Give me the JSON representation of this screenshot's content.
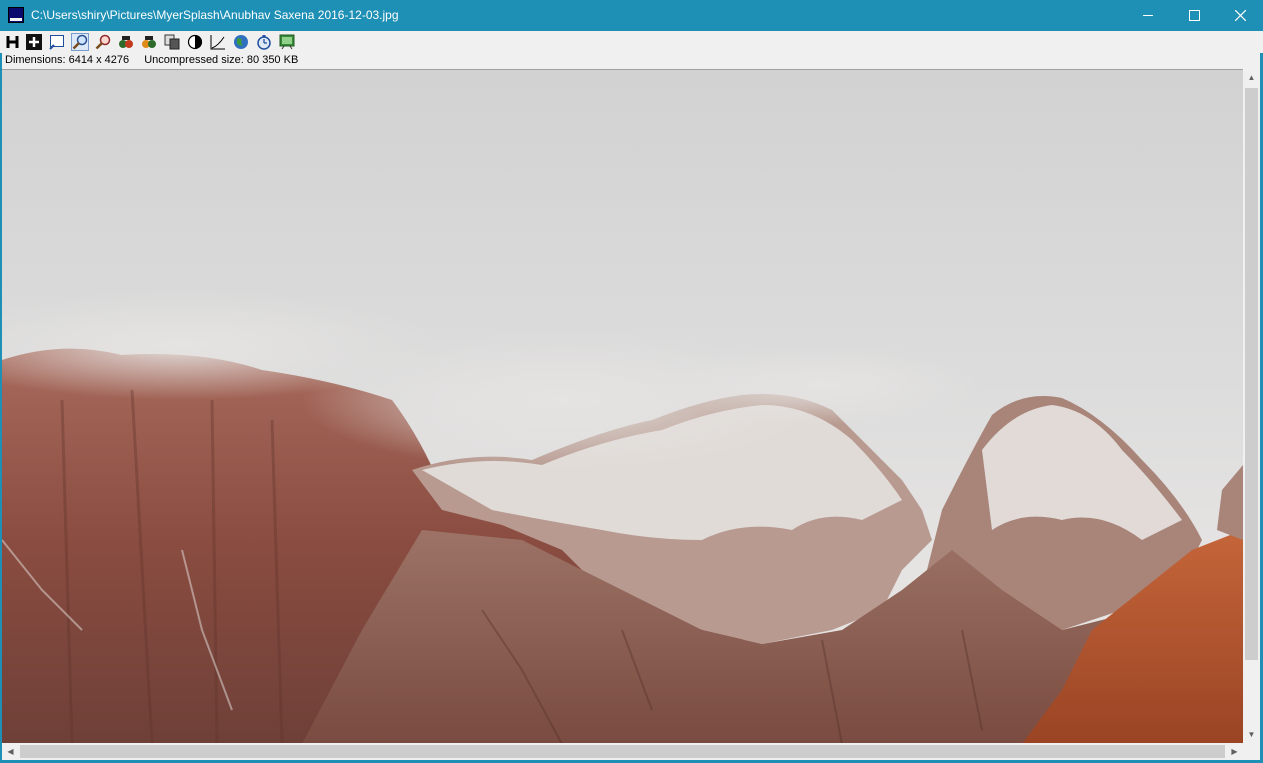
{
  "window": {
    "title": "C:\\Users\\shiry\\Pictures\\MyerSplash\\Anubhav Saxena  2016-12-03.jpg",
    "controls": [
      "minimize",
      "maximize",
      "close"
    ]
  },
  "toolbar": {
    "buttons": [
      {
        "icon": "histogram-h-icon",
        "label": "H"
      },
      {
        "icon": "add-plus-icon"
      },
      {
        "icon": "fit-window-icon"
      },
      {
        "icon": "zoom-in-icon",
        "active": true
      },
      {
        "icon": "zoom-out-icon"
      },
      {
        "icon": "red-eye-icon"
      },
      {
        "icon": "color-icon"
      },
      {
        "icon": "copy-icon"
      },
      {
        "icon": "contrast-icon"
      },
      {
        "icon": "curve-icon"
      },
      {
        "icon": "globe-icon"
      },
      {
        "icon": "timer-icon"
      },
      {
        "icon": "slideshow-icon"
      }
    ]
  },
  "info": {
    "dimensions": "Dimensions: 6414 x 4276",
    "size": "Uncompressed size: 80 350 KB"
  },
  "colors": {
    "titlebar": "#1e8fb5",
    "sky": "#d4d4d4",
    "rock": "#8e5043",
    "snow": "#e8e6e4"
  }
}
